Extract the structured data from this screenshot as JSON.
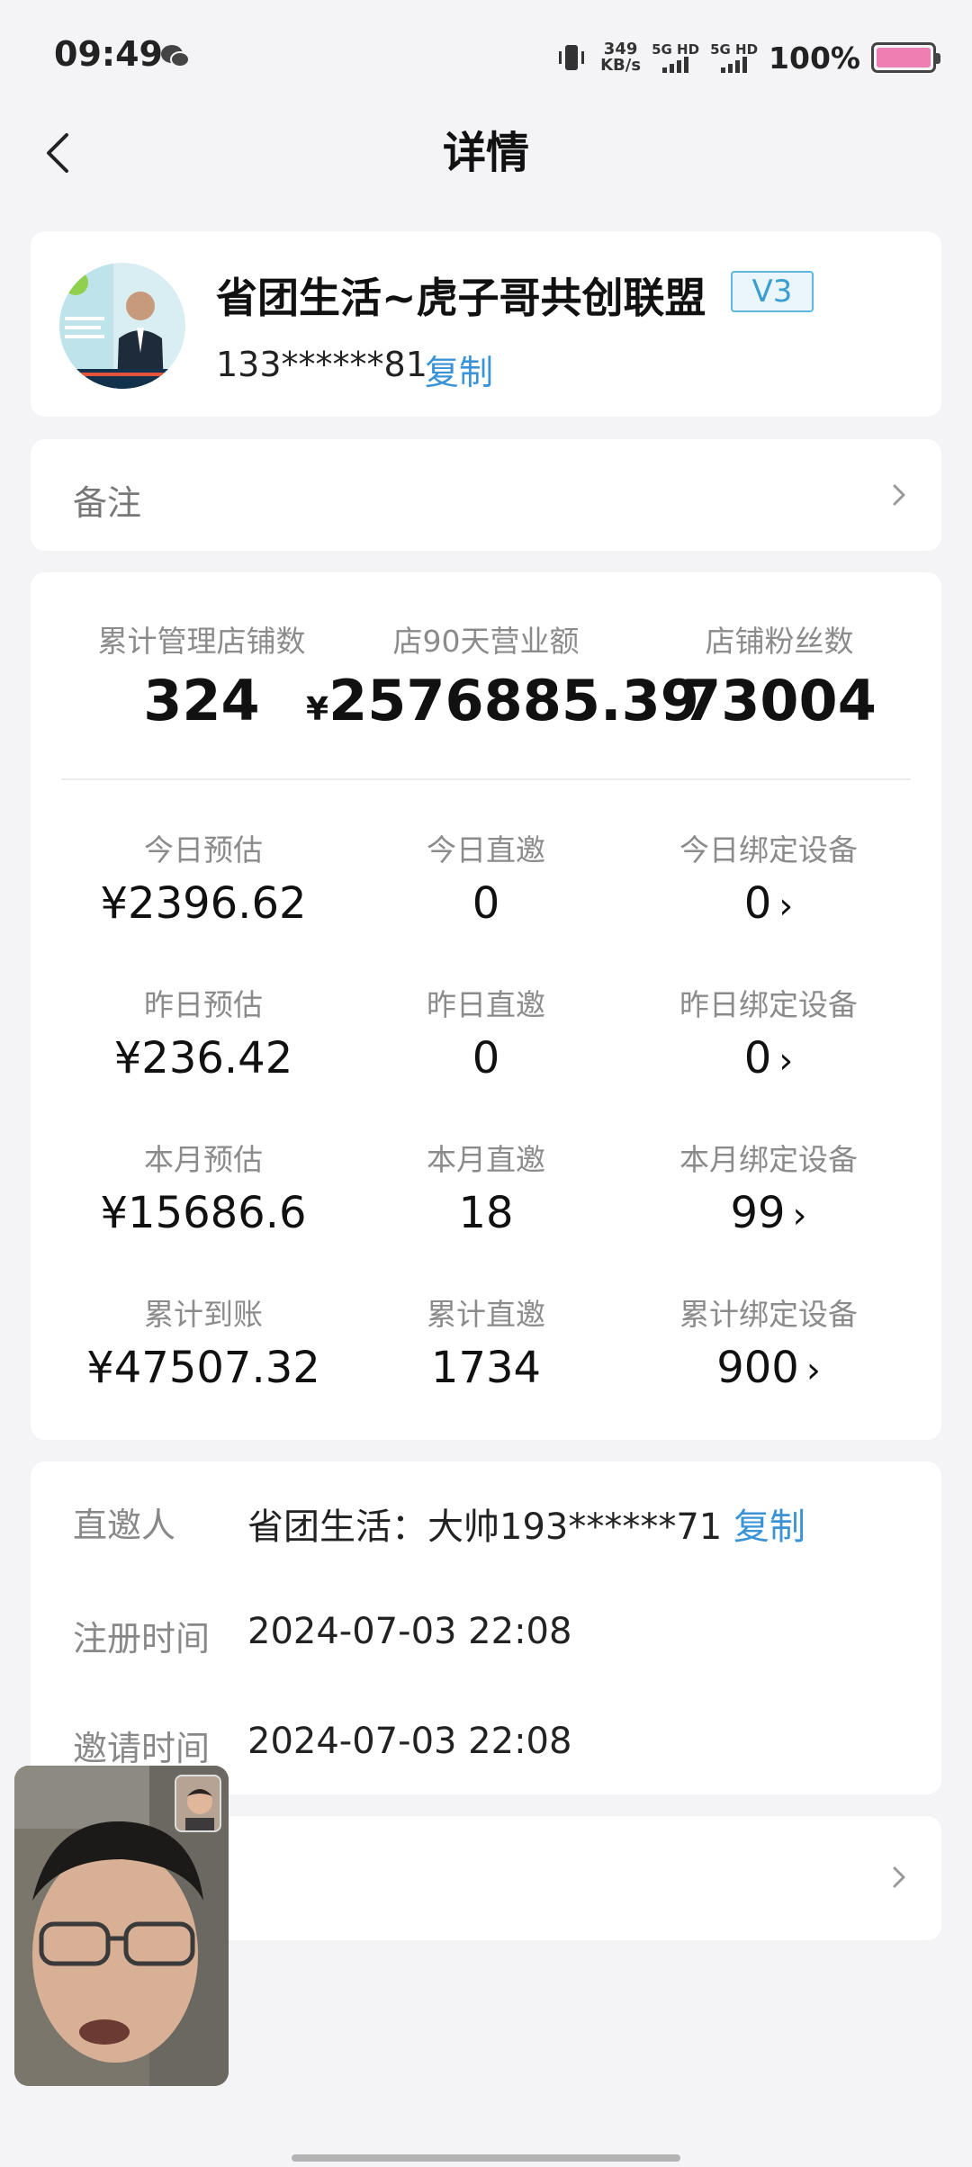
{
  "status_bar": {
    "time": "09:49",
    "net_speed_value": "349",
    "net_speed_unit": "KB/s",
    "sim1_label": "5G HD",
    "sim2_label": "5G HD",
    "battery_pct": "100%",
    "battery_color": "#ef7fb3"
  },
  "header": {
    "title": "详情"
  },
  "profile": {
    "name": "省团生活~虎子哥共创联盟",
    "level": "V3",
    "phone": "133******81",
    "copy_label": "复制"
  },
  "remark": {
    "label": "备注"
  },
  "stats_top": [
    {
      "label": "累计管理店铺数",
      "value": "324",
      "prefix": ""
    },
    {
      "label": "店90天营业额",
      "value": "2576885.39",
      "prefix": "¥"
    },
    {
      "label": "店铺粉丝数",
      "value": "73004",
      "prefix": ""
    }
  ],
  "stats_grid": [
    [
      {
        "label": "今日预估",
        "value": "¥2396.62"
      },
      {
        "label": "今日直邀",
        "value": "0"
      },
      {
        "label": "今日绑定设备",
        "value": "0"
      }
    ],
    [
      {
        "label": "昨日预估",
        "value": "¥236.42"
      },
      {
        "label": "昨日直邀",
        "value": "0"
      },
      {
        "label": "昨日绑定设备",
        "value": "0"
      }
    ],
    [
      {
        "label": "本月预估",
        "value": "¥15686.6"
      },
      {
        "label": "本月直邀",
        "value": "18"
      },
      {
        "label": "本月绑定设备",
        "value": "99"
      }
    ],
    [
      {
        "label": "累计到账",
        "value": "¥47507.32"
      },
      {
        "label": "累计直邀",
        "value": "1734"
      },
      {
        "label": "累计绑定设备",
        "value": "900"
      }
    ]
  ],
  "info": {
    "inviter_label": "直邀人",
    "inviter_value": "省团生活：大帅193******71",
    "copy_label": "复制",
    "register_label": "注册时间",
    "register_value": "2024-07-03 22:08",
    "invite_label": "邀请时间",
    "invite_value": "2024-07-03 22:08"
  },
  "colors": {
    "accent": "#3a93d6",
    "background": "#f4f4f6"
  }
}
